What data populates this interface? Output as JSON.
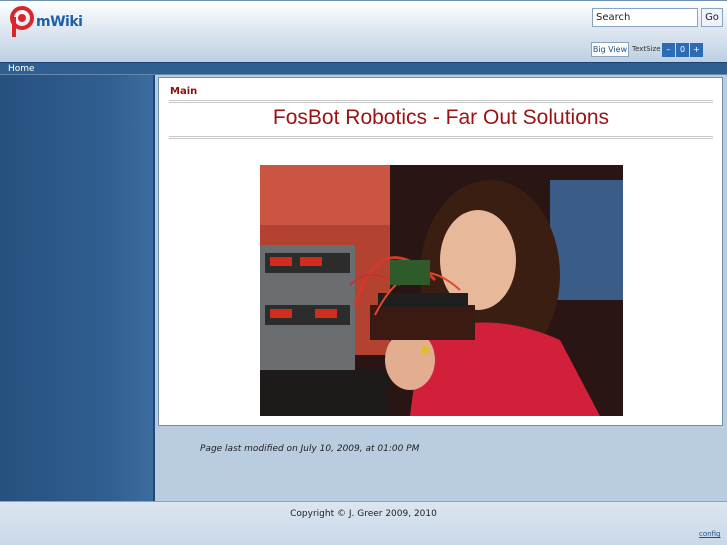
{
  "header": {
    "logo_text": "mWiki",
    "search": {
      "value": "Search"
    },
    "go_label": "Go",
    "bigview_label": "Big View",
    "textsize_label": "TextSize",
    "textsize_buttons": [
      "–",
      "0",
      "+"
    ]
  },
  "nav": {
    "home_label": "Home"
  },
  "content": {
    "group": "Main",
    "title": "FosBot Robotics - Far Out Solutions"
  },
  "modified": "Page last modified on July 10, 2009, at 01:00 PM",
  "footer": {
    "copyright": "Copyright © J. Greer 2009, 2010",
    "config_label": "config"
  },
  "colors": {
    "accent": "#2f5f91",
    "title_red": "#9a1212",
    "button_blue": "#2d6bb3"
  }
}
